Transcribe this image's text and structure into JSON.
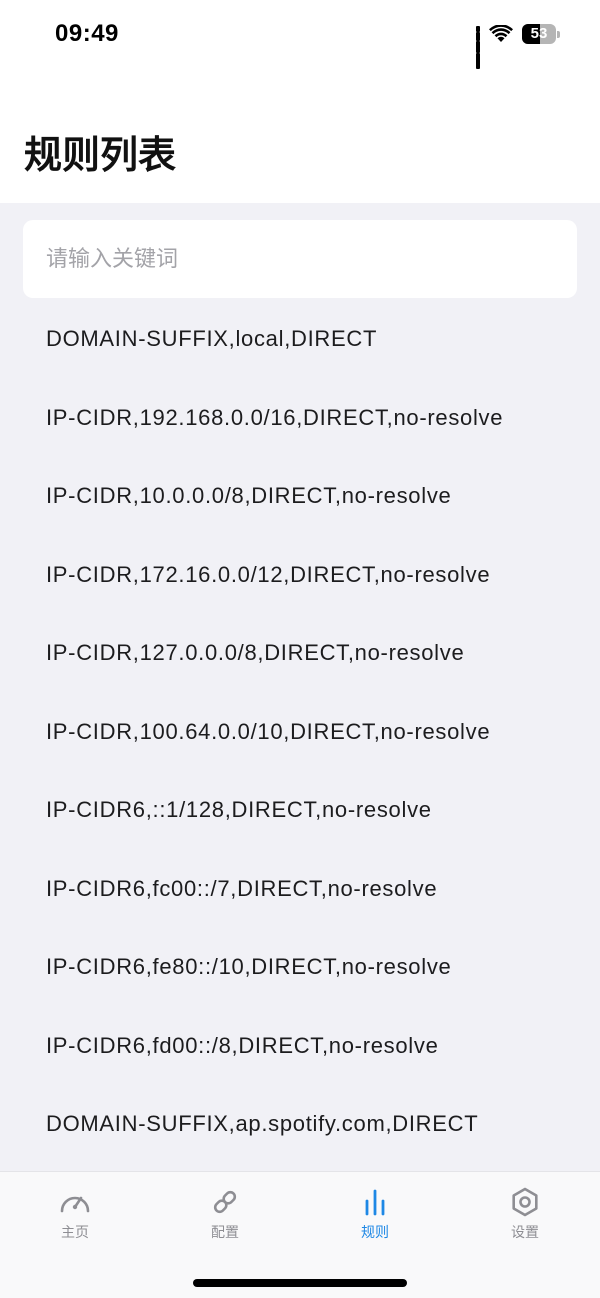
{
  "status_bar": {
    "time": "09:49",
    "battery_level": "53",
    "battery_fraction": 0.53
  },
  "header": {
    "title": "规则列表"
  },
  "search": {
    "placeholder": "请输入关键词",
    "value": ""
  },
  "rules": [
    "DOMAIN-SUFFIX,local,DIRECT",
    "IP-CIDR,192.168.0.0/16,DIRECT,no-resolve",
    "IP-CIDR,10.0.0.0/8,DIRECT,no-resolve",
    "IP-CIDR,172.16.0.0/12,DIRECT,no-resolve",
    "IP-CIDR,127.0.0.0/8,DIRECT,no-resolve",
    "IP-CIDR,100.64.0.0/10,DIRECT,no-resolve",
    "IP-CIDR6,::1/128,DIRECT,no-resolve",
    "IP-CIDR6,fc00::/7,DIRECT,no-resolve",
    "IP-CIDR6,fe80::/10,DIRECT,no-resolve",
    "IP-CIDR6,fd00::/8,DIRECT,no-resolve",
    "DOMAIN-SUFFIX,ap.spotify.com,DIRECT"
  ],
  "tab_bar": {
    "tabs": [
      {
        "label": "主页",
        "icon": "speedometer-icon",
        "active": false
      },
      {
        "label": "配置",
        "icon": "link-icon",
        "active": false
      },
      {
        "label": "规则",
        "icon": "bars-icon",
        "active": true
      },
      {
        "label": "设置",
        "icon": "settings-hexagon-icon",
        "active": false
      }
    ]
  },
  "colors": {
    "accent": "#1e88e5",
    "inactive": "#8e8e93",
    "background": "#f1f1f6"
  }
}
